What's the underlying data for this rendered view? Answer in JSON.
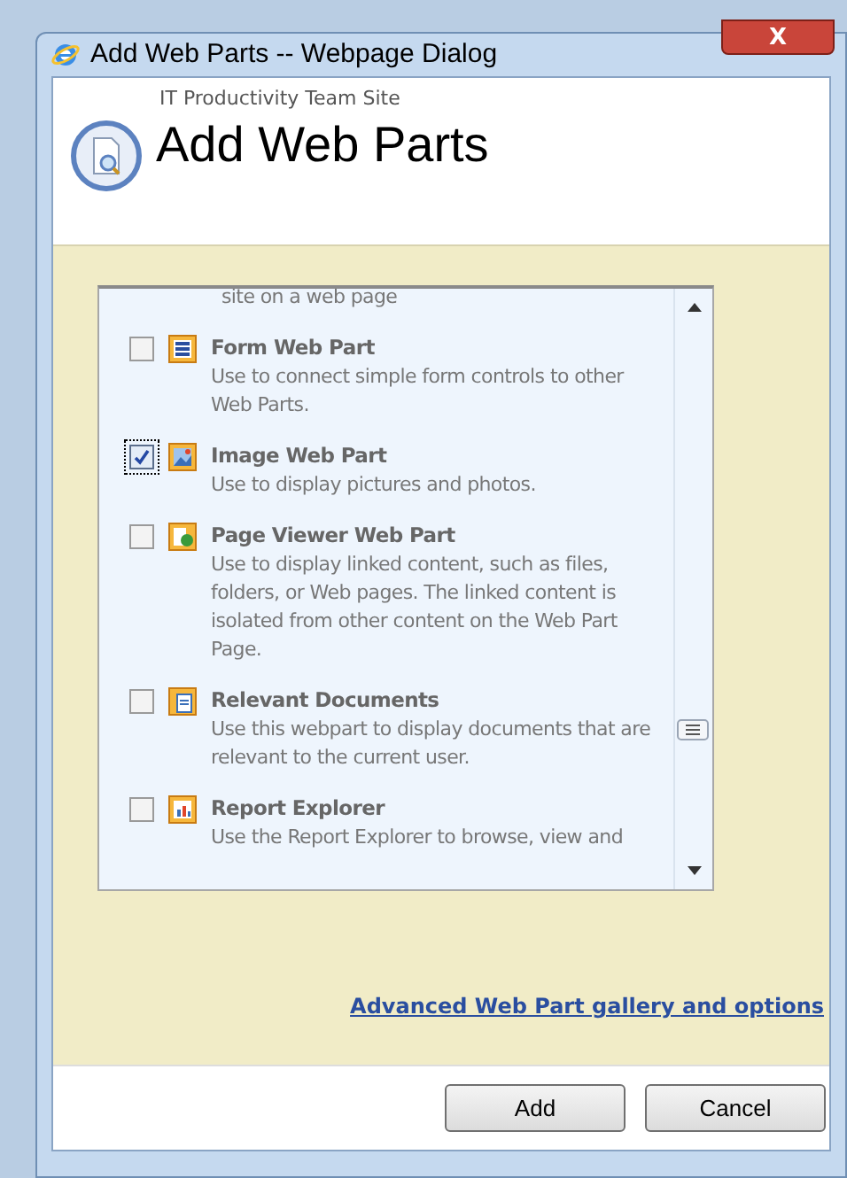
{
  "window": {
    "title": "Add Web Parts -- Webpage Dialog",
    "close": "X"
  },
  "header": {
    "site": "IT Productivity Team Site",
    "title": "Add Web Parts"
  },
  "list": {
    "cut_off_text": "site on a web page",
    "items": [
      {
        "kind": "form",
        "title": "Form Web Part",
        "description": "Use to connect simple form controls to other Web Parts.",
        "checked": false
      },
      {
        "kind": "image",
        "title": "Image Web Part",
        "description": "Use to display pictures and photos.",
        "checked": true
      },
      {
        "kind": "page",
        "title": "Page Viewer Web Part",
        "description": "Use to display linked content, such as files, folders, or Web pages. The linked content is isolated from other content on the Web Part Page.",
        "checked": false
      },
      {
        "kind": "documents",
        "title": "Relevant Documents",
        "description": "Use this webpart to display documents that are relevant to the current user.",
        "checked": false
      },
      {
        "kind": "report",
        "title": "Report Explorer",
        "description": "Use the Report Explorer to browse, view and",
        "checked": false
      }
    ]
  },
  "link": "Advanced Web Part gallery and options",
  "buttons": [
    "Add",
    "Cancel"
  ]
}
